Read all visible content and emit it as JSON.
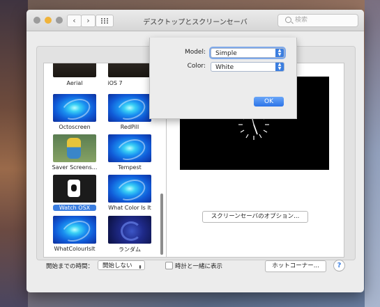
{
  "window": {
    "title": "デスクトップとスクリーンセーバ"
  },
  "search": {
    "placeholder": "検索"
  },
  "savers": [
    {
      "label": "Aerial"
    },
    {
      "label": "iOS 7"
    },
    {
      "label": "Octoscreen"
    },
    {
      "label": "RedPill"
    },
    {
      "label": "Saver Screens..."
    },
    {
      "label": "Tempest"
    },
    {
      "label": "Watch OSX"
    },
    {
      "label": "What Color Is It"
    },
    {
      "label": "WhatColourIsIt"
    },
    {
      "label": "ランダム"
    }
  ],
  "selected_saver": "Watch OSX",
  "preview": {
    "options_button": "スクリーンセーバのオプション..."
  },
  "bottom": {
    "start_label": "開始までの時間：",
    "start_value": "開始しない",
    "clock_checkbox_label": "時計と一緒に表示",
    "hot_corners_button": "ホットコーナー...",
    "help": "?"
  },
  "sheet": {
    "model_label": "Model:",
    "model_value": "Simple",
    "color_label": "Color:",
    "color_value": "White",
    "ok_label": "OK"
  },
  "colors": {
    "accent": "#3b7ee0",
    "preview_bg": "#000000"
  }
}
